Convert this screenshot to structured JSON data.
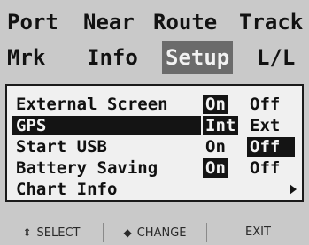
{
  "tabs_row1": [
    {
      "label": "Port"
    },
    {
      "label": "Near"
    },
    {
      "label": "Route"
    },
    {
      "label": "Track"
    }
  ],
  "tabs_row2": [
    {
      "label": "Mrk"
    },
    {
      "label": "Info"
    },
    {
      "label": "Setup",
      "selected": true
    },
    {
      "label": "L/L"
    }
  ],
  "settings": [
    {
      "label": "External Screen",
      "options": [
        "On",
        "Off"
      ],
      "selected": "On"
    },
    {
      "label": "GPS",
      "options": [
        "Int",
        "Ext"
      ],
      "selected": "Int",
      "highlighted": true
    },
    {
      "label": "Start USB",
      "options": [
        "On",
        "Off"
      ],
      "selected": "Off"
    },
    {
      "label": "Battery Saving",
      "options": [
        "On",
        "Off"
      ],
      "selected": "On"
    },
    {
      "label": "Chart Info",
      "has_submenu": true
    }
  ],
  "softkeys": {
    "select": {
      "icon": "updown-arrow-icon",
      "glyph": "⇕",
      "label": "SELECT"
    },
    "change": {
      "icon": "leftright-arrow-icon",
      "glyph": "◆",
      "label": "CHANGE"
    },
    "exit": {
      "label": "EXIT"
    }
  },
  "colors": {
    "background": "#c9c9c9",
    "panel": "#f0f0f0",
    "selected_tab": "#6b6b6b",
    "highlight": "#141414"
  }
}
